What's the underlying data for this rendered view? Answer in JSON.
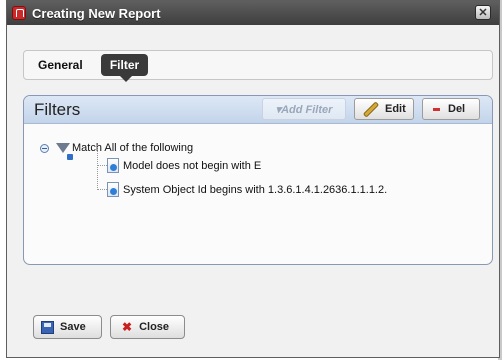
{
  "dialog": {
    "title": "Creating New Report",
    "close_glyph": "✕"
  },
  "tabs": [
    {
      "label": "General",
      "selected": false
    },
    {
      "label": "Filter",
      "selected": true
    }
  ],
  "filters_panel": {
    "title": "Filters",
    "toolbar": {
      "add_filter_label": "▾Add Filter",
      "edit_label": "Edit",
      "del_label": "Del"
    },
    "tree": {
      "root_label": "Match All of the following",
      "children": [
        "Model does not begin with E",
        "System Object Id begins with 1.3.6.1.4.1.2636.1.1.1.2."
      ]
    }
  },
  "footer": {
    "save_label": "Save",
    "close_label": "Close",
    "close_glyph": "✖"
  }
}
